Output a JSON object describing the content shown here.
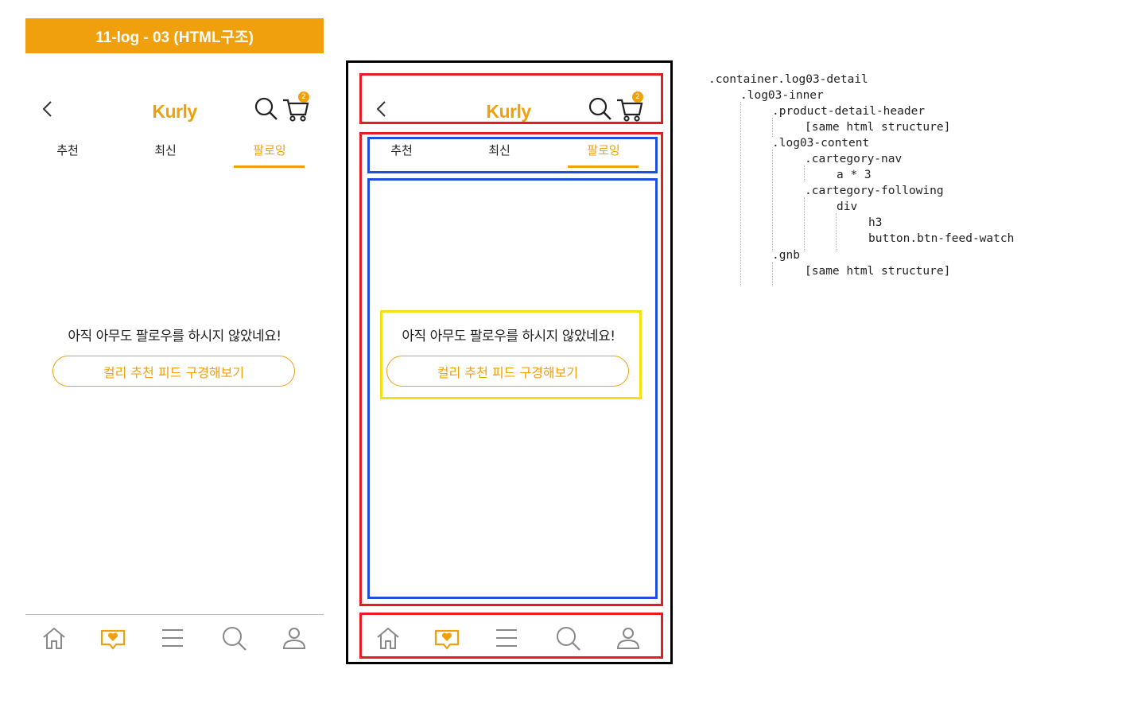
{
  "title": "11-log - 03  (HTML구조)",
  "header": {
    "logo": "Kurly",
    "cart_count": "2"
  },
  "nav": {
    "tabs": [
      "추천",
      "최신",
      "팔로잉"
    ],
    "active_tab": "팔로잉"
  },
  "following": {
    "message": "아직 아무도 팔로우를 하시지 않았네요!",
    "button_label": "컬리 추천 피드 구경해보기"
  },
  "gnb": {
    "icons": [
      "home-icon",
      "feed-heart-icon",
      "menu-icon",
      "search-icon",
      "user-icon"
    ]
  },
  "colors": {
    "accent": "#f0a00c",
    "red_box": "#e51c23",
    "blue_box": "#1f4fe0",
    "yellow_box": "#f5e10f"
  },
  "code_tree": [
    ".container.log03-detail",
    ".log03-inner",
    ".product-detail-header",
    "[same html structure]",
    ".log03-content",
    ".cartegory-nav",
    "a * 3",
    ".cartegory-following",
    "div",
    "h3",
    "button.btn-feed-watch",
    ".gnb",
    "[same html structure]"
  ]
}
